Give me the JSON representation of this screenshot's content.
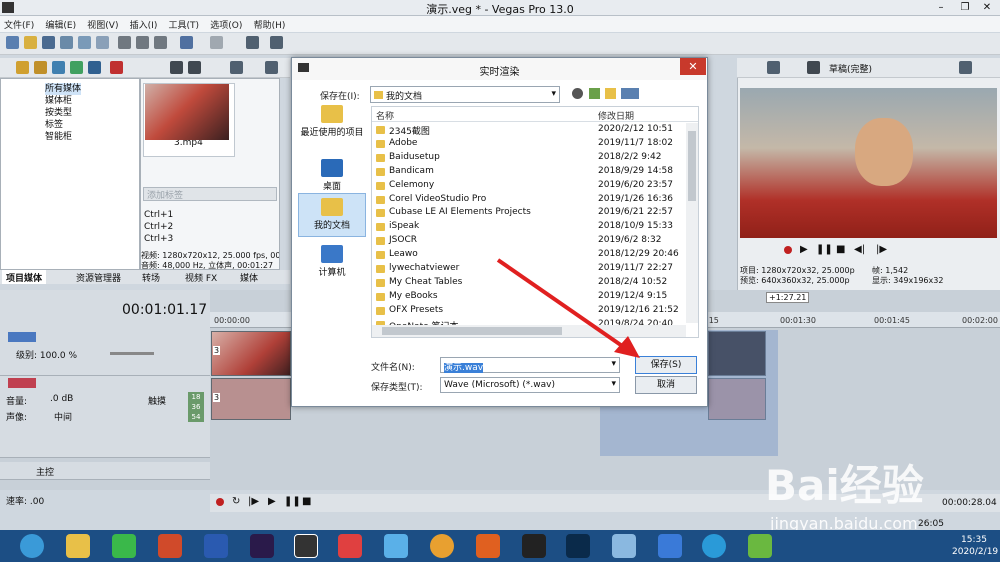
{
  "app": {
    "title": "演示.veg * - Vegas Pro 13.0"
  },
  "menu": [
    "文件(F)",
    "编辑(E)",
    "视图(V)",
    "插入(I)",
    "工具(T)",
    "选项(O)",
    "帮助(H)"
  ],
  "explorer": {
    "items": [
      "所有媒体",
      "媒体柜",
      "按类型",
      "标签",
      "智能柜"
    ]
  },
  "media": {
    "thumb_label": "3.mp4",
    "tag_placeholder": "添加标签",
    "shortcuts": [
      "Ctrl+1",
      "Ctrl+2",
      "Ctrl+3"
    ],
    "info_video": "视频: 1280x720x12, 25.000 fps, 00:",
    "info_audio": "音频: 48,000 Hz, 立体声, 00:01:27"
  },
  "panel_tabs": [
    "项目媒体",
    "资源管理器",
    "转场",
    "视频 FX",
    "媒体"
  ],
  "preview": {
    "mode": "草稿(完整)",
    "project": "项目: 1280x720x32, 25.000p",
    "preview_res": "预览: 640x360x32, 25.000p",
    "frame_label": "帧:",
    "frame": "1,542",
    "display": "显示: 349x196x32"
  },
  "timeline": {
    "timecode": "00:01:01.17",
    "ruler": [
      "00:00:00",
      ":15",
      "00:01:30",
      "00:01:45",
      "00:02:00"
    ],
    "marker": "+1:27.21",
    "track1_level": "级别: 100.0 %",
    "track2_vol_label": "音量:",
    "track2_vol": ".0 dB",
    "track2_pan_label": "声像:",
    "track2_pan": "中间",
    "track2_mode": "触摸",
    "meter": [
      "18",
      "36",
      "54"
    ],
    "master": "主控",
    "rate": "速率: .00",
    "end_time": "00:00:28.04",
    "end_time2": "26:05",
    "clip_num": "3"
  },
  "dialog": {
    "title": "实时渲染",
    "save_in_label": "保存在(I):",
    "save_in": "我的文档",
    "places": [
      "最近使用的项目",
      "桌面",
      "我的文档",
      "计算机"
    ],
    "col_name": "名称",
    "col_date": "修改日期",
    "files": [
      {
        "name": "2345截图",
        "date": "2020/2/12 10:51"
      },
      {
        "name": "Adobe",
        "date": "2019/11/7 18:02"
      },
      {
        "name": "Baidusetup",
        "date": "2018/2/2 9:42"
      },
      {
        "name": "Bandicam",
        "date": "2018/9/29 14:58"
      },
      {
        "name": "Celemony",
        "date": "2019/6/20 23:57"
      },
      {
        "name": "Corel VideoStudio Pro",
        "date": "2019/1/26 16:36"
      },
      {
        "name": "Cubase LE AI Elements Projects",
        "date": "2019/6/21 22:57"
      },
      {
        "name": "iSpeak",
        "date": "2018/10/9 15:33"
      },
      {
        "name": "JSOCR",
        "date": "2019/6/2 8:32"
      },
      {
        "name": "Leawo",
        "date": "2018/12/29 20:46"
      },
      {
        "name": "lywechatviewer",
        "date": "2019/11/7 22:27"
      },
      {
        "name": "My Cheat Tables",
        "date": "2018/2/4 10:52"
      },
      {
        "name": "My eBooks",
        "date": "2019/12/4 9:15"
      },
      {
        "name": "OFX Presets",
        "date": "2019/12/16 21:52"
      },
      {
        "name": "OneNote 笔记本",
        "date": "2019/8/24 20:40"
      }
    ],
    "filename_label": "文件名(N):",
    "filename": "演示.wav",
    "filetype_label": "保存类型(T):",
    "filetype": "Wave (Microsoft) (*.wav)",
    "save_button": "保存(S)",
    "cancel_button": "取消"
  },
  "taskbar": {
    "time": "15:35",
    "date": "2020/2/19"
  },
  "watermark": {
    "brand": "Bai经验",
    "url": "jingyan.baidu.com"
  },
  "colors": {
    "accent": "#1c4e84",
    "arrow": "#e02020",
    "close": "#c8392b"
  }
}
